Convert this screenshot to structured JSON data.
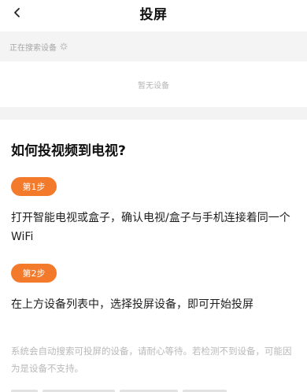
{
  "header": {
    "title": "投屏",
    "back_icon": "chevron-left-icon"
  },
  "search": {
    "status": "正在搜索设备",
    "spinner_icon": "loading-spinner-icon",
    "empty": "暂无设备"
  },
  "guide": {
    "title": "如何投视频到电视?",
    "steps": [
      {
        "badge": "第1步",
        "text": "打开智能电视或盒子，确认电视/盒子与手机连接着同一个WiFi"
      },
      {
        "badge": "第2步",
        "text": "在上方设备列表中，选择投屏设备，即可开始投屏"
      }
    ],
    "note": "系统会自动搜索可投屏的设备，请耐心等待。若检测不到设备，可能因为是设备不支持。"
  },
  "colors": {
    "accent": "#f37a2a",
    "muted_text": "#b9b9b9",
    "band": "#f3f3f3"
  }
}
